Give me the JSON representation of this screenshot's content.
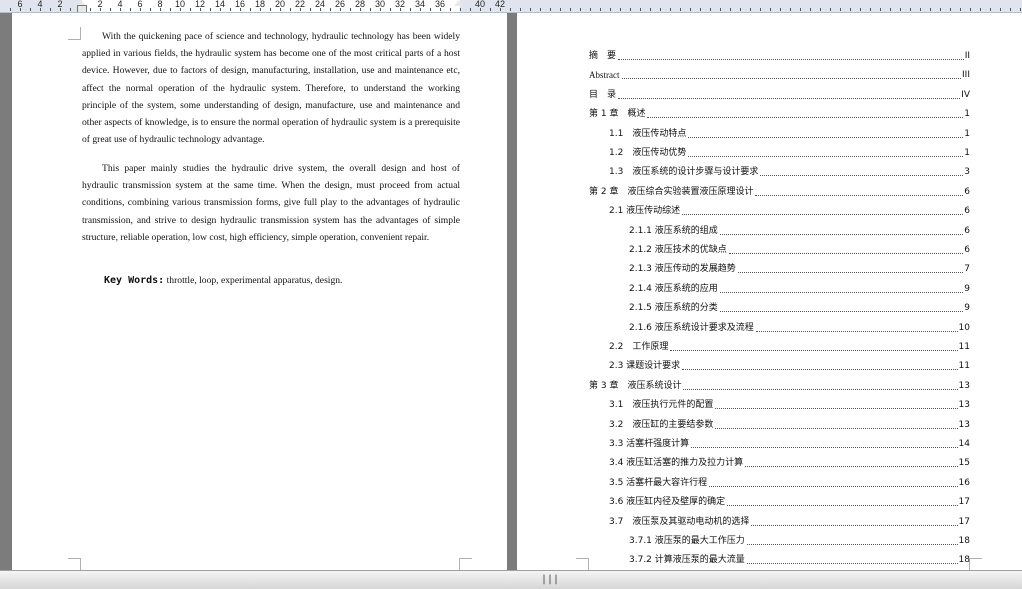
{
  "ruler": {
    "numbers": [
      "6",
      "4",
      "2",
      "2",
      "4",
      "6",
      "8",
      "10",
      "12",
      "14",
      "16",
      "18",
      "20",
      "22",
      "24",
      "26",
      "28",
      "30",
      "32",
      "34",
      "36",
      "40",
      "42"
    ]
  },
  "left_page": {
    "paragraphs": [
      "With the quickening pace of science and technology, hydraulic technology has been widely applied in various fields, the hydraulic system has become one of the most critical parts of a host device. However, due to factors of design, manufacturing, installation, use and maintenance etc, affect the normal operation of the hydraulic system. Therefore, to understand the working principle of the system, some understanding of design, manufacture, use and maintenance and other aspects of knowledge, is to ensure the normal operation of hydraulic system is a prerequisite of great use of hydraulic technology advantage.",
      "This paper mainly studies the hydraulic drive system, the overall design and host of hydraulic transmission system at the same time. When the design, must proceed from actual conditions, combining various transmission forms, give full play to the advantages of hydraulic transmission, and strive to design hydraulic transmission system has the advantages of simple structure, reliable operation, low cost, high efficiency, simple operation, convenient repair."
    ],
    "keywords_label": "Key Words:",
    "keywords_text": "throttle, loop, experimental apparatus, design."
  },
  "toc": [
    {
      "title": "摘　要",
      "page": "II",
      "level": 0
    },
    {
      "title": "Abstract",
      "page": "III",
      "level": 0
    },
    {
      "title": "目　录",
      "page": "IV",
      "level": 0
    },
    {
      "title": "第 1 章　概述",
      "page": "1",
      "level": 0
    },
    {
      "title": "1.1　液压传动特点",
      "page": "1",
      "level": 1
    },
    {
      "title": "1.2　液压传动优势",
      "page": "1",
      "level": 1
    },
    {
      "title": "1.3　液压系统的设计步骤与设计要求",
      "page": "3",
      "level": 1
    },
    {
      "title": "第 2 章　液压综合实验装置液压原理设计",
      "page": "6",
      "level": 0
    },
    {
      "title": "2.1 液压传动综述",
      "page": "6",
      "level": 1
    },
    {
      "title": "2.1.1 液压系统的组成",
      "page": "6",
      "level": 2
    },
    {
      "title": "2.1.2 液压技术的优缺点",
      "page": "6",
      "level": 2
    },
    {
      "title": "2.1.3 液压传动的发展趋势",
      "page": "7",
      "level": 2
    },
    {
      "title": "2.1.4 液压系统的应用",
      "page": "9",
      "level": 2
    },
    {
      "title": "2.1.5 液压系统的分类",
      "page": "9",
      "level": 2
    },
    {
      "title": "2.1.6 液压系统设计要求及流程",
      "page": "10",
      "level": 2
    },
    {
      "title": "2.2　工作原理",
      "page": "11",
      "level": 1
    },
    {
      "title": "2.3 课题设计要求",
      "page": "11",
      "level": 1
    },
    {
      "title": "第 3 章　液压系统设计",
      "page": "13",
      "level": 0
    },
    {
      "title": "3.1　液压执行元件的配置",
      "page": "13",
      "level": 1
    },
    {
      "title": "3.2　液压缸的主要结参数",
      "page": "13",
      "level": 1
    },
    {
      "title": "3.3 活塞杆强度计算",
      "page": "14",
      "level": 1
    },
    {
      "title": "3.4 液压缸活塞的推力及拉力计算",
      "page": "15",
      "level": 1
    },
    {
      "title": "3.5 活塞杆最大容许行程",
      "page": "16",
      "level": 1
    },
    {
      "title": "3.6 液压缸内径及壁厚的确定",
      "page": "17",
      "level": 1
    },
    {
      "title": "3.7　液压泵及其驱动电动机的选择",
      "page": "17",
      "level": 1
    },
    {
      "title": "3.7.1 液压泵的最大工作压力",
      "page": "18",
      "level": 2
    },
    {
      "title": "3.7.2 计算液压泵的最大流量",
      "page": "18",
      "level": 2
    }
  ]
}
